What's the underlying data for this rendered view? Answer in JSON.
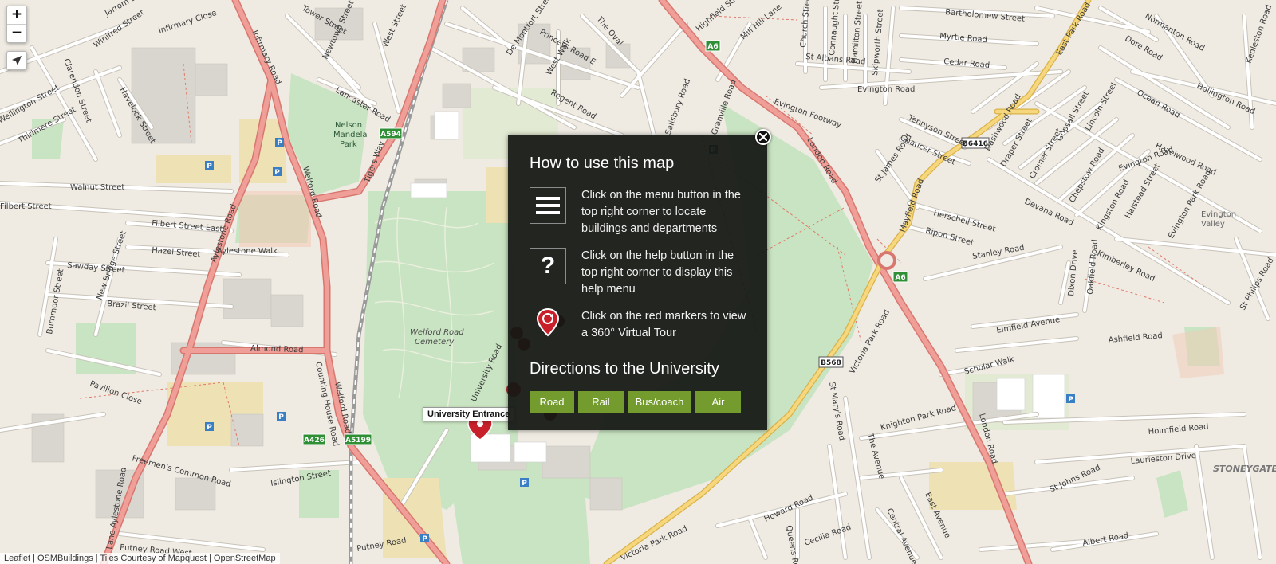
{
  "map": {
    "streets": [
      "Jarrom St",
      "Tower Street",
      "Winifred Street",
      "Infirmary Close",
      "Infirmary Road",
      "Clarendon Street",
      "Newtown Street",
      "West Street",
      "Havelock Street",
      "Lancaster Road",
      "Nelson Mandela Park",
      "Walnut Street",
      "Wellington Street",
      "Thirlmere Street",
      "Filbert Street",
      "Filbert Street East",
      "Aylestone Road",
      "Welford Road",
      "Tigers Way",
      "Hazel Street",
      "Aylestone Walk",
      "Sawday Street",
      "New Bridge Street",
      "Brazil Street",
      "Burnmoor Street",
      "Almond Road",
      "Pavilion Close",
      "Counting House Road",
      "Welford Road Cemetery",
      "University Road",
      "Freemen's Common Road",
      "Islington Street",
      "Putney Road West",
      "Putney Road",
      "De Montfort Street",
      "Princess Road E",
      "West Walk",
      "The Oval",
      "Regent Road",
      "Highfield Street",
      "Mill Hill Lane",
      "Church Street",
      "Connaught Street",
      "Hamilton Street",
      "Skipworth Street",
      "St Albans Road",
      "Evington Road",
      "Evington Footway",
      "Bartholomew Street",
      "Myrtle Road",
      "Cedar Road",
      "Tennyson Street",
      "Chaucer Street",
      "London Road",
      "Mayfield Road",
      "Granville Road",
      "Salisbury Road",
      "St James Road",
      "Herschell Street",
      "Ripon Street",
      "East Park Road",
      "Dore Road",
      "Normanton Road",
      "Gopsall Street",
      "Lincoln Street",
      "Cromer Street",
      "Draper Street",
      "Dashwood Road",
      "Chepstow Road",
      "Devana Road",
      "Kingston Road",
      "Halstead Street",
      "Kimberley Road",
      "Evington Valley",
      "Stanley Road",
      "Oakfield Road",
      "Dixon Drive",
      "Elmfield Avenue",
      "Ashfield Road",
      "Scholar Walk",
      "Knighton Park Road",
      "Victoria Park Road",
      "St Mary's Road",
      "The Avenue",
      "Holmfield Road",
      "Laurieston Drive",
      "St Johns Road",
      "Central Avenue",
      "East Avenue",
      "Howard Road",
      "Cecilia Road",
      "Queens Road",
      "Albert Road",
      "Stoneygate",
      "Kedleston Road",
      "Hollington Road",
      "Ocean Road",
      "Hazelwood Road",
      "Evington Park Road",
      "St Philips Road",
      "Medland Road"
    ],
    "road_badges": [
      {
        "text": "A6",
        "type": "green"
      },
      {
        "text": "A594",
        "type": "green"
      },
      {
        "text": "A6",
        "type": "green"
      },
      {
        "text": "A426",
        "type": "green"
      },
      {
        "text": "A5199",
        "type": "green"
      },
      {
        "text": "B568",
        "type": "white"
      },
      {
        "text": "B6416",
        "type": "white"
      }
    ],
    "parking_label": "P"
  },
  "controls": {
    "zoom_in": "+",
    "zoom_out": "−"
  },
  "marker_label": "University Entrance",
  "attribution": "Leaflet | OSMBuildings | Tiles Courtesy of Mapquest | OpenStreetMap",
  "help_panel": {
    "title": "How to use this map",
    "items": [
      {
        "icon": "menu-icon",
        "text": "Click on the menu button in the top right corner to locate buildings and departments"
      },
      {
        "icon": "help-icon",
        "text": "Click on the help button in the top right corner to display this help menu"
      },
      {
        "icon": "marker-icon",
        "text": "Click on the red markers to view a 360° Virtual Tour"
      }
    ],
    "directions_title": "Directions to the University",
    "direction_buttons": [
      "Road",
      "Rail",
      "Bus/coach",
      "Air"
    ],
    "help_icon_glyph": "?"
  },
  "colors": {
    "map_bg": "#efebe3",
    "park": "#c6e3c0",
    "major_road": "#e88a8a",
    "yellow_road": "#f4d06c",
    "panel_bg": "#161814",
    "button": "#739b2e",
    "marker": "#c8202a"
  }
}
